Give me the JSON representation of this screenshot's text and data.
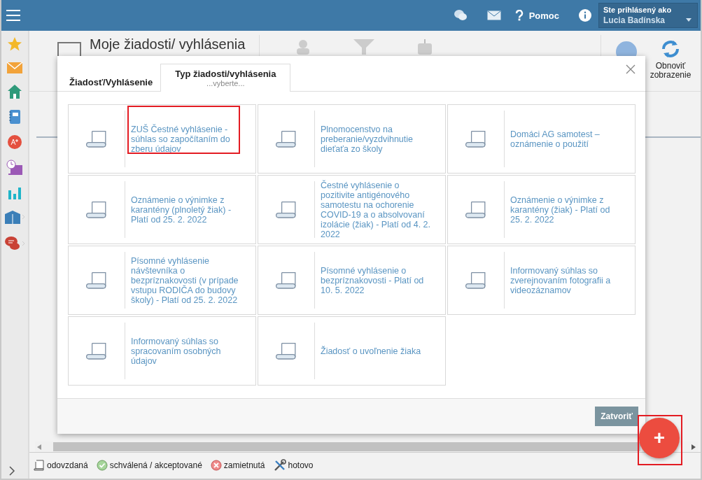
{
  "topbar": {
    "help": "Pomoc",
    "user_label": "Ste prihlásený ako",
    "user_name": "Lucia Badínska"
  },
  "page": {
    "title": "Moje žiadosti/ vyhlásenia",
    "refresh": "Obnoviť zobrazenie"
  },
  "modal": {
    "tabs": [
      {
        "label": "Žiadosť/Vyhlásenie",
        "selected": false
      },
      {
        "label": "Typ žiadosti/vyhlásenia",
        "sublabel": "...vyberte...",
        "selected": true
      }
    ],
    "items": [
      {
        "label": "ZUŠ Čestné vyhlásenie - súhlas so započítaním do zberu údajov",
        "highlighted": true
      },
      {
        "label": "Plnomocenstvo na preberanie/vyzdvihnutie dieťaťa zo školy",
        "highlighted": false
      },
      {
        "label": "Domáci AG samotest – oznámenie o použití",
        "highlighted": false
      },
      {
        "label": "Oznámenie o výnimke z karantény (plnoletý žiak) - Platí od 25. 2. 2022",
        "highlighted": false
      },
      {
        "label": "Čestné vyhlásenie o pozitivite antigénového samotestu na ochorenie COVID-19 a o absolvovaní izolácie (žiak) - Platí od 4. 2. 2022",
        "highlighted": false
      },
      {
        "label": "Oznámenie o výnimke z karantény (žiak) - Platí od 25. 2. 2022",
        "highlighted": false
      },
      {
        "label": "Písomné vyhlásenie návštevníka o bezpríznakovosti (v prípade vstupu RODIČA do budovy školy) - Platí od 25. 2. 2022",
        "highlighted": false
      },
      {
        "label": "Písomné vyhlásenie o bezpríznakovosti - Platí od 10. 5. 2022",
        "highlighted": false
      },
      {
        "label": "Informovaný súhlas so zverejnovaním fotografii a videozáznamov",
        "highlighted": false
      },
      {
        "label": "Informovaný súhlas so spracovaním osobných údajov",
        "highlighted": false
      },
      {
        "label": "Žiadosť o uvoľnenie žiaka",
        "highlighted": false
      }
    ],
    "close_button": "Zatvoriť"
  },
  "fab": {
    "label": "+",
    "highlighted": true
  },
  "legend": [
    {
      "kind": "submitted",
      "label": "odovzdaná"
    },
    {
      "kind": "approved",
      "label": "schválená / akceptované"
    },
    {
      "kind": "rejected",
      "label": "zamietnutá"
    },
    {
      "kind": "done",
      "label": "hotovo"
    }
  ]
}
